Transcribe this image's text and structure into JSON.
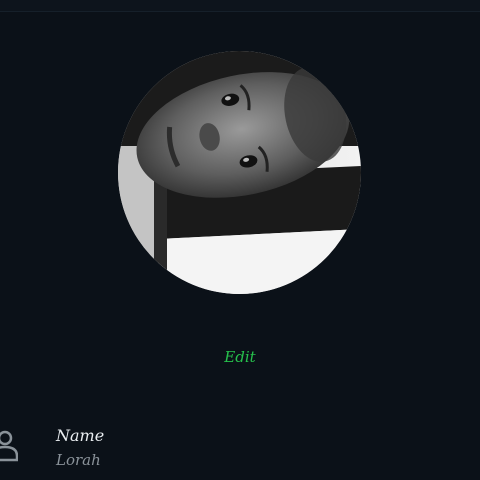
{
  "profile": {
    "avatar_icon": "profile-photo",
    "edit_label": "Edit",
    "accent_color": "#26c14c",
    "background_color": "#0b1118"
  },
  "fields": {
    "name": {
      "icon": "person-icon",
      "label": "Name",
      "value": "Lorah"
    }
  }
}
